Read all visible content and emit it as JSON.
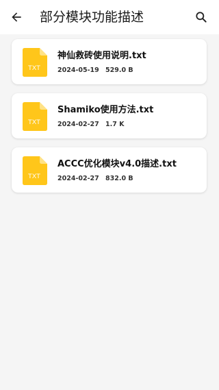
{
  "header": {
    "title": "部分模块功能描述",
    "back_icon": "arrow-left-icon",
    "search_icon": "search-icon"
  },
  "colors": {
    "file_icon": "#FFC61A",
    "file_icon_fold": "#FFE285",
    "icon_text": "#FFFFFF"
  },
  "files": [
    {
      "name": "神仙救砖使用说明.txt",
      "date": "2024-05-19",
      "size": "529.0 B",
      "ext": "TXT",
      "icon": "txt-file-icon"
    },
    {
      "name": "Shamiko使用方法.txt",
      "date": "2024-02-27",
      "size": "1.7 K",
      "ext": "TXT",
      "icon": "txt-file-icon"
    },
    {
      "name": "ACCC优化模块v4.0描述.txt",
      "date": "2024-02-27",
      "size": "832.0 B",
      "ext": "TXT",
      "icon": "txt-file-icon"
    }
  ]
}
